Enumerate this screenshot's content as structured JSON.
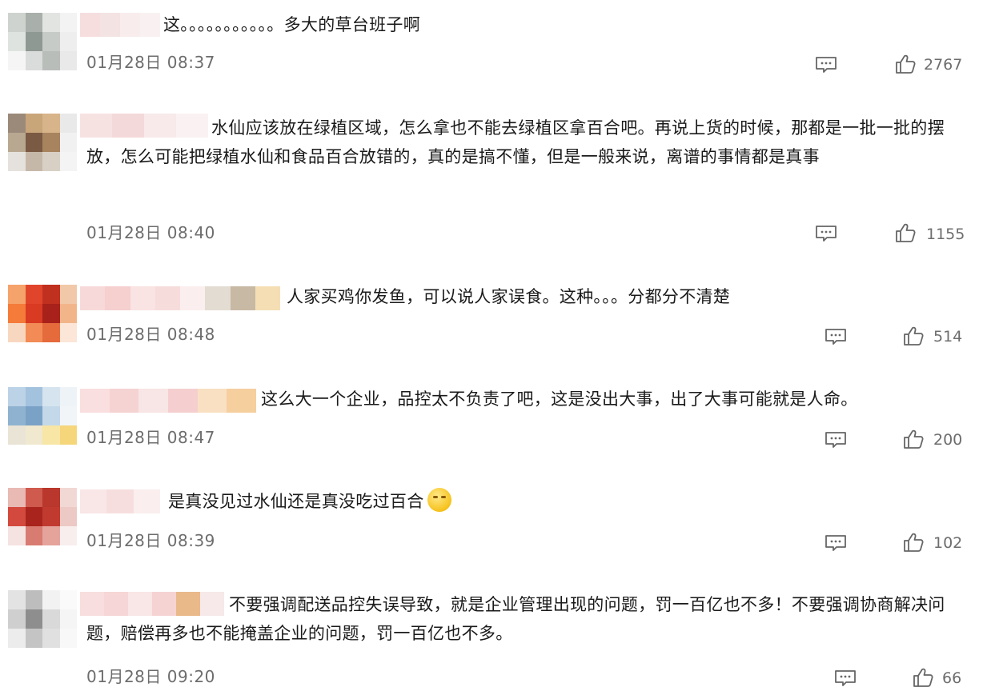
{
  "comments": [
    {
      "text": "这。。。。。。。。。。。多大的草台班子啊",
      "time": "01月28日 08:37",
      "likes": "2767",
      "avatar_colors": [
        "#cfd3cf",
        "#a9b0ab",
        "#e2e4e2",
        "#f3f3f3",
        "#dfe3e0",
        "#8f9993",
        "#c6cbc7",
        "#eeeeee",
        "#f5f5f5",
        "#d9dcda",
        "#b8bdb9",
        "#e8e9e8"
      ],
      "name_colors": [
        "#f6dede",
        "#f4e3e3",
        "#f8ecec",
        "#f9f1f1"
      ]
    },
    {
      "text": "水仙应该放在绿植区域，怎么拿也不能去绿植区拿百合吧。再说上货的时候，那都是一批一批的摆放，怎么可能把绿植水仙和食品百合放错的，真的是搞不懂，但是一般来说，离谱的事情都是真事",
      "time": "01月28日 08:40",
      "likes": "1155",
      "avatar_colors": [
        "#9b8a7a",
        "#c9a57a",
        "#d8b48a",
        "#e9e9e9",
        "#b9a891",
        "#7a5a43",
        "#a7835e",
        "#f1f1f1",
        "#e5e2de",
        "#c6b8a8",
        "#d9d0c5",
        "#f4f4f4"
      ],
      "name_colors": [
        "#f7e2e2",
        "#f3d9d9",
        "#f8eaea",
        "#faf2f2"
      ]
    },
    {
      "text": "人家买鸡你发鱼，可以说人家误食。这种。。。分都分不清楚",
      "time": "01月28日 08:48",
      "likes": "514",
      "avatar_colors": [
        "#f6a26b",
        "#e0452c",
        "#c0301f",
        "#f1c9a8",
        "#f47b3a",
        "#d93a22",
        "#a8211a",
        "#f2b58a",
        "#f8d7c0",
        "#f28b55",
        "#e56a3c",
        "#fbe6d8"
      ],
      "name_colors": [
        "#f8d9d9",
        "#f6cfcf",
        "#f9e3e3",
        "#f7dcdc",
        "#fbeeee",
        "#e3dcd2",
        "#c8b9a5",
        "#f5deb3"
      ]
    },
    {
      "text": "这么大一个企业，品控太不负责了吧，这是没出大事，出了大事可能就是人命。",
      "time": "01月28日 08:47",
      "likes": "200",
      "avatar_colors": [
        "#bcd2e6",
        "#a3c2de",
        "#d6e4ef",
        "#eef3f7",
        "#8fb2d0",
        "#7aa2c6",
        "#c3d8e9",
        "#f1f5f8",
        "#e9e4d6",
        "#f0e8cf",
        "#f7e6a6",
        "#f5d67a"
      ],
      "name_colors": [
        "#f9dfdf",
        "#f6d3d3",
        "#f8e5e5",
        "#f5cfcf",
        "#f9e0c2",
        "#f6cf9f"
      ]
    },
    {
      "text": "是真没见过水仙还是真没吃过百合",
      "time": "01月28日 08:39",
      "likes": "102",
      "avatar_colors": [
        "#e9b9b4",
        "#cf5a4e",
        "#b9372c",
        "#f2d8d4",
        "#d4493d",
        "#a8241c",
        "#c13a2f",
        "#ecc9c4",
        "#f5e3e1",
        "#d87b70",
        "#e4a39b",
        "#f8eeed"
      ],
      "name_colors": [
        "#f9e6e6",
        "#f7dede",
        "#faeeee"
      ]
    },
    {
      "text": "不要强调配送品控失误导致，就是企业管理出现的问题，罚一百亿也不多！不要强调协商解决问题，赔偿再多也不能掩盖企业的问题，罚一百亿也不多。",
      "time": "01月28日 09:20",
      "likes": "66",
      "avatar_colors": [
        "#e3e3e3",
        "#bdbdbd",
        "#f2f2f2",
        "#fafafa",
        "#cfcfcf",
        "#8e8e8e",
        "#d9d9d9",
        "#f5f5f5",
        "#ececec",
        "#c4c4c4",
        "#e0e0e0",
        "#f8f8f8"
      ],
      "name_colors": [
        "#f8dede",
        "#f6d6d6",
        "#f9e6e6",
        "#f5d3d3",
        "#e9b98a",
        "#f7e9e9"
      ]
    }
  ],
  "icons": {
    "reply": "comment-bubble-icon",
    "like": "thumbs-up-icon"
  },
  "colors": {
    "text": "#1a1a1a",
    "meta": "#6d6d6d"
  }
}
